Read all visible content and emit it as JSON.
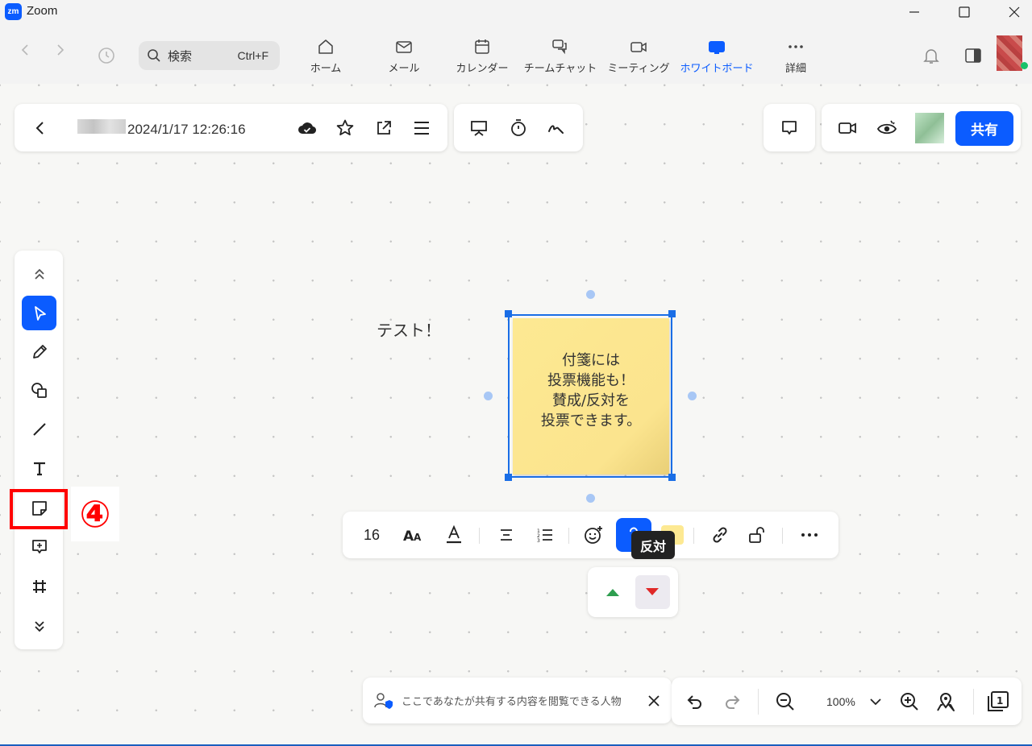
{
  "window": {
    "app_name": "Zoom",
    "logo_text": "zm"
  },
  "nav": {
    "search_label": "検索",
    "search_shortcut": "Ctrl+F",
    "tabs": [
      {
        "label": "ホーム",
        "icon": "home-icon"
      },
      {
        "label": "メール",
        "icon": "mail-icon"
      },
      {
        "label": "カレンダー",
        "icon": "calendar-icon"
      },
      {
        "label": "チームチャット",
        "icon": "chat-icon"
      },
      {
        "label": "ミーティング",
        "icon": "video-icon"
      },
      {
        "label": "ホワイトボード",
        "icon": "whiteboard-icon",
        "active": true
      },
      {
        "label": "詳細",
        "icon": "more-icon"
      }
    ]
  },
  "whiteboard": {
    "title": "2024/1/17 12:26:16",
    "share_label": "共有",
    "canvas_text": "テスト！",
    "sticky_note_text": "付箋には\n投票機能も！\n賛成/反対を\n投票できます。"
  },
  "format_toolbar": {
    "font_size": "16",
    "tooltip": "反対"
  },
  "annotation": {
    "step_number": "④",
    "color": "#ff0000"
  },
  "bottom": {
    "notice_text": "ここであなたが共有する内容を閲覧できる人物",
    "zoom_level": "100%"
  },
  "colors": {
    "accent": "#0b5cff",
    "sticky": "#fde992",
    "vote_up": "#2e9e4f",
    "vote_down": "#e02828"
  }
}
